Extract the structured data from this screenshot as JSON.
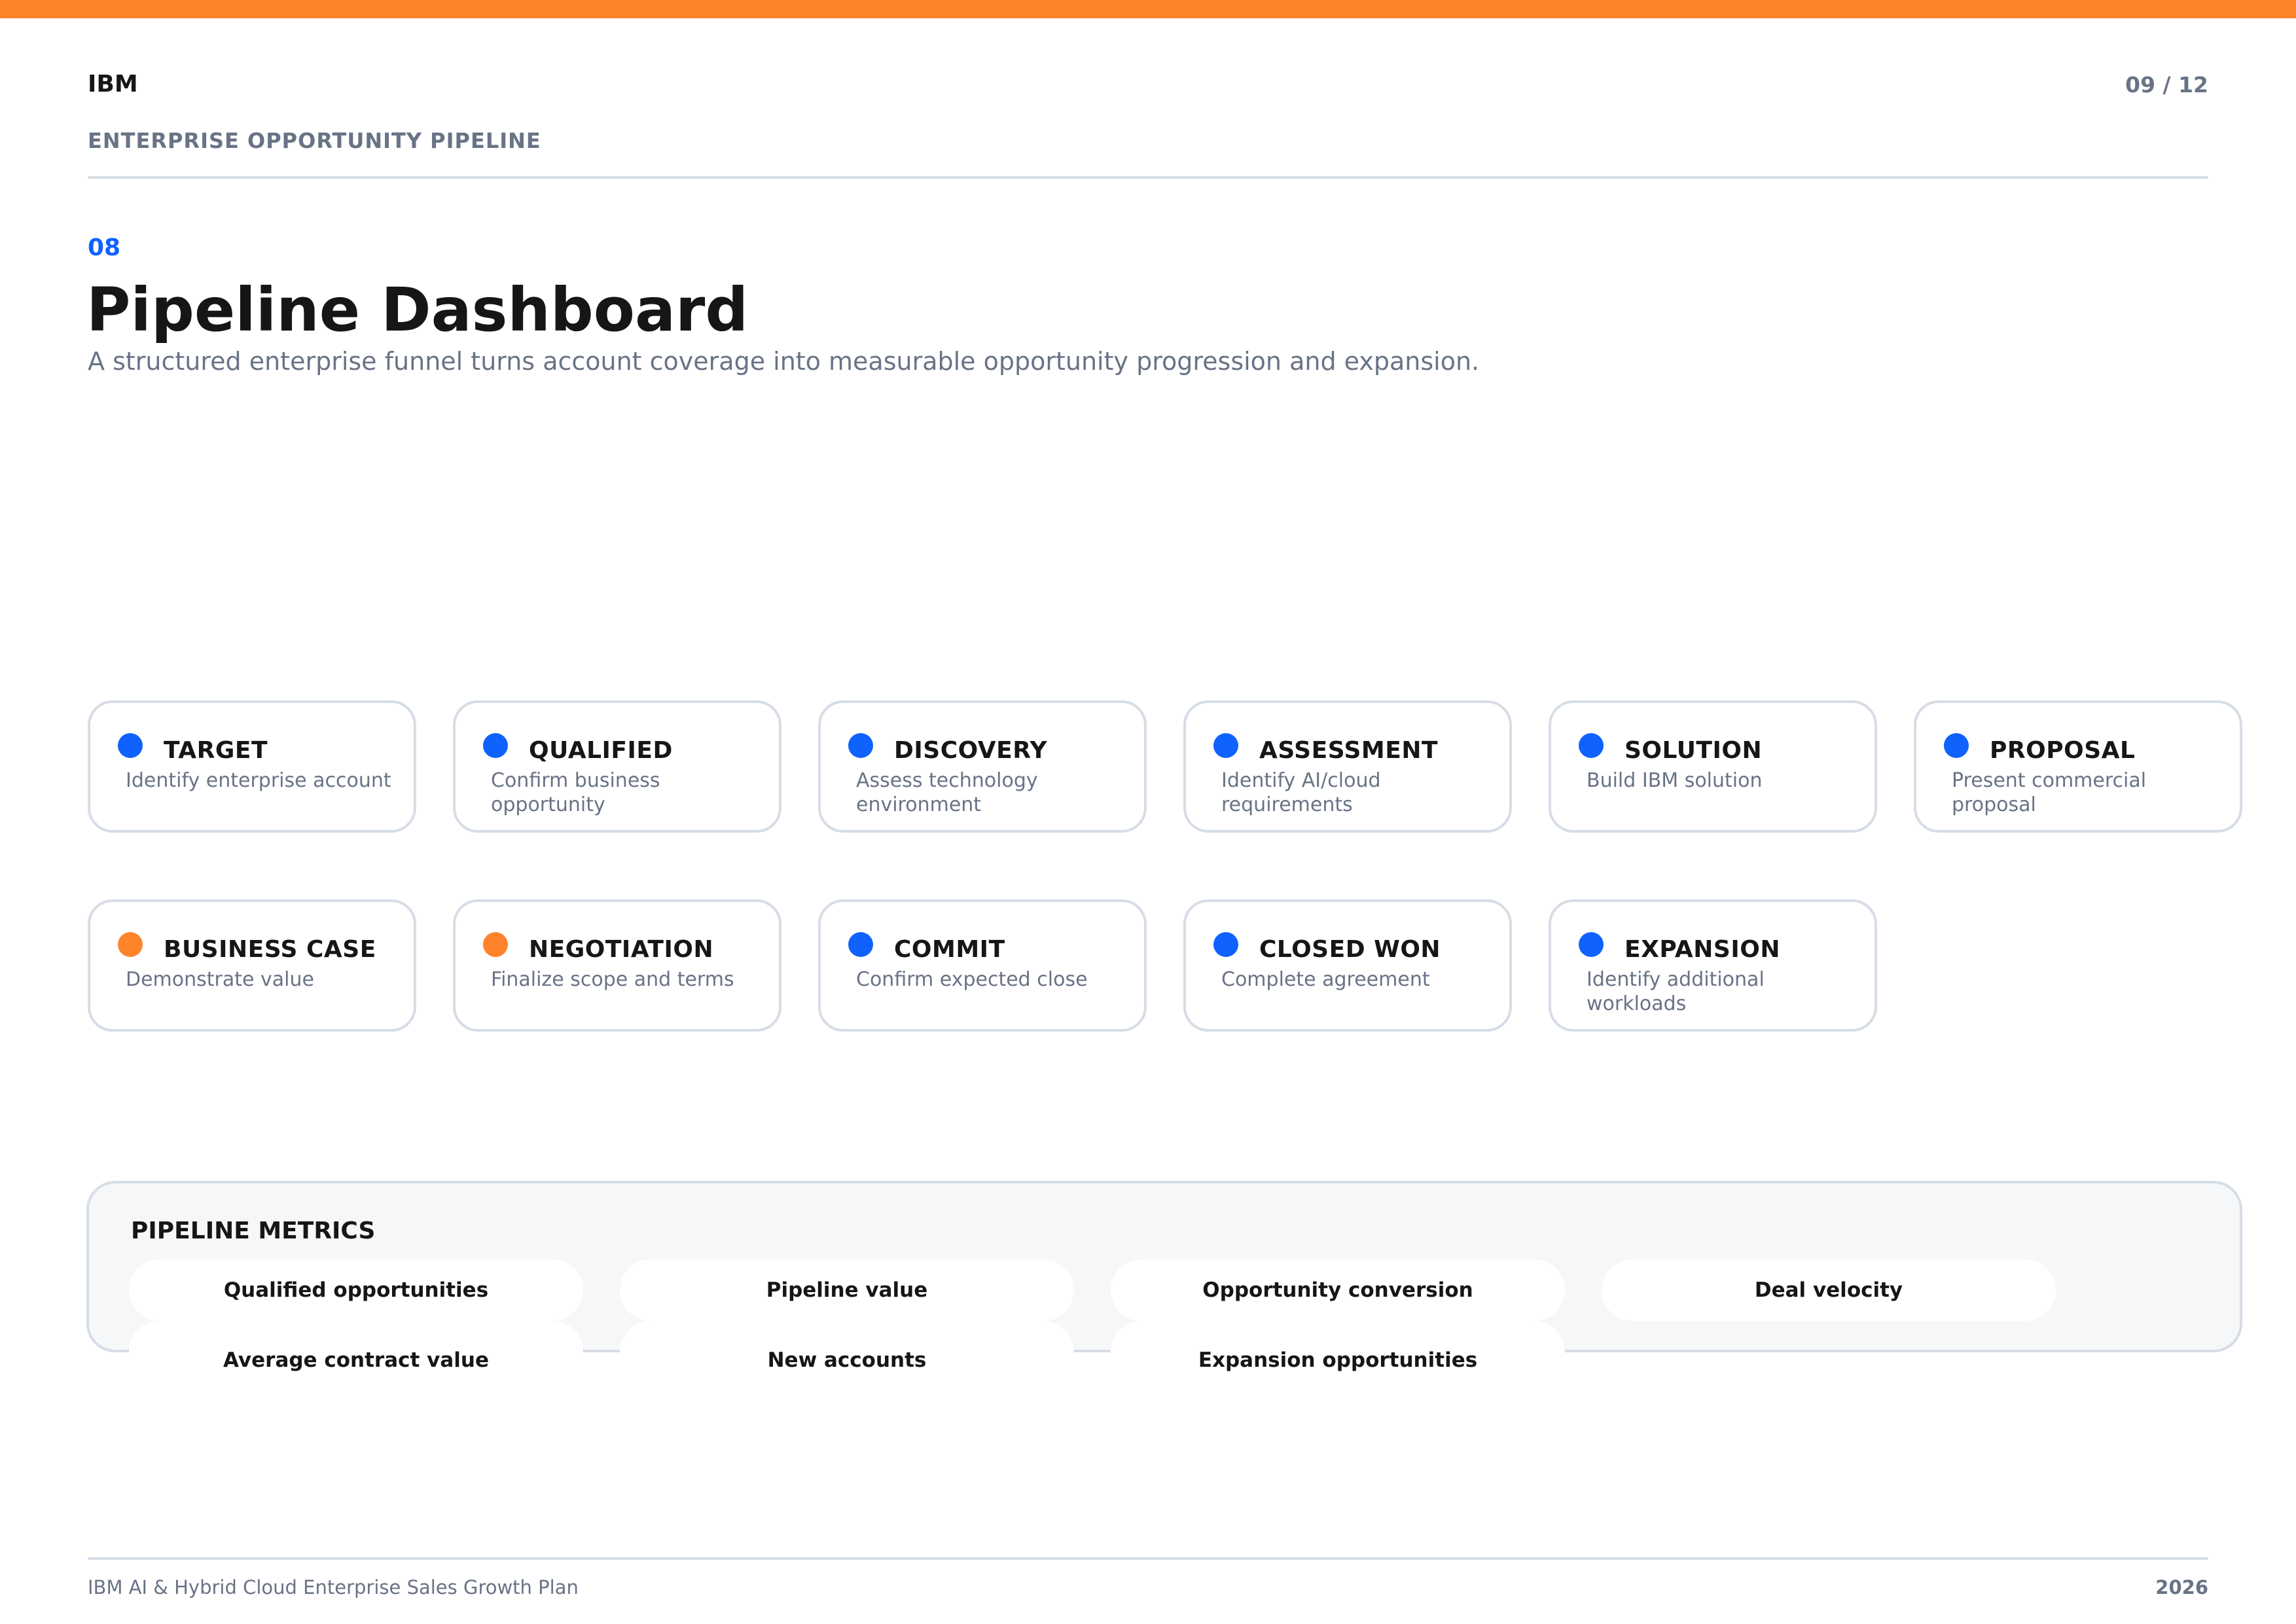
{
  "colors": {
    "accent_orange": "#ff832b",
    "accent_blue": "#0f62fe",
    "muted_text": "#697386",
    "border": "#d6dde6"
  },
  "header": {
    "brand": "IBM",
    "section": "ENTERPRISE OPPORTUNITY PIPELINE",
    "page_number": "09 / 12"
  },
  "slide": {
    "number": "08",
    "title": "Pipeline Dashboard",
    "subtitle": "A structured enterprise funnel turns account coverage into measurable opportunity progression and expansion."
  },
  "stages": [
    {
      "name": "TARGET",
      "description": "Identify enterprise account",
      "status_color": "#0f62fe"
    },
    {
      "name": "QUALIFIED",
      "description": "Confirm business opportunity",
      "status_color": "#0f62fe"
    },
    {
      "name": "DISCOVERY",
      "description": "Assess technology environment",
      "status_color": "#0f62fe"
    },
    {
      "name": "ASSESSMENT",
      "description": "Identify AI/cloud requirements",
      "status_color": "#0f62fe"
    },
    {
      "name": "SOLUTION",
      "description": "Build IBM solution",
      "status_color": "#0f62fe"
    },
    {
      "name": "PROPOSAL",
      "description": "Present commercial proposal",
      "status_color": "#0f62fe"
    },
    {
      "name": "BUSINESS CASE",
      "description": "Demonstrate value",
      "status_color": "#ff832b"
    },
    {
      "name": "NEGOTIATION",
      "description": "Finalize scope and terms",
      "status_color": "#ff832b"
    },
    {
      "name": "COMMIT",
      "description": "Confirm expected close",
      "status_color": "#0f62fe"
    },
    {
      "name": "CLOSED WON",
      "description": "Complete agreement",
      "status_color": "#0f62fe"
    },
    {
      "name": "EXPANSION",
      "description": "Identify additional workloads",
      "status_color": "#0f62fe"
    }
  ],
  "metrics": {
    "title": "PIPELINE METRICS",
    "items": [
      "Qualified opportunities",
      "Pipeline value",
      "Opportunity conversion",
      "Deal velocity",
      "Average contract value",
      "New accounts",
      "Expansion opportunities"
    ]
  },
  "footer": {
    "plan_name": "IBM AI & Hybrid Cloud Enterprise Sales Growth Plan",
    "year": "2026"
  }
}
